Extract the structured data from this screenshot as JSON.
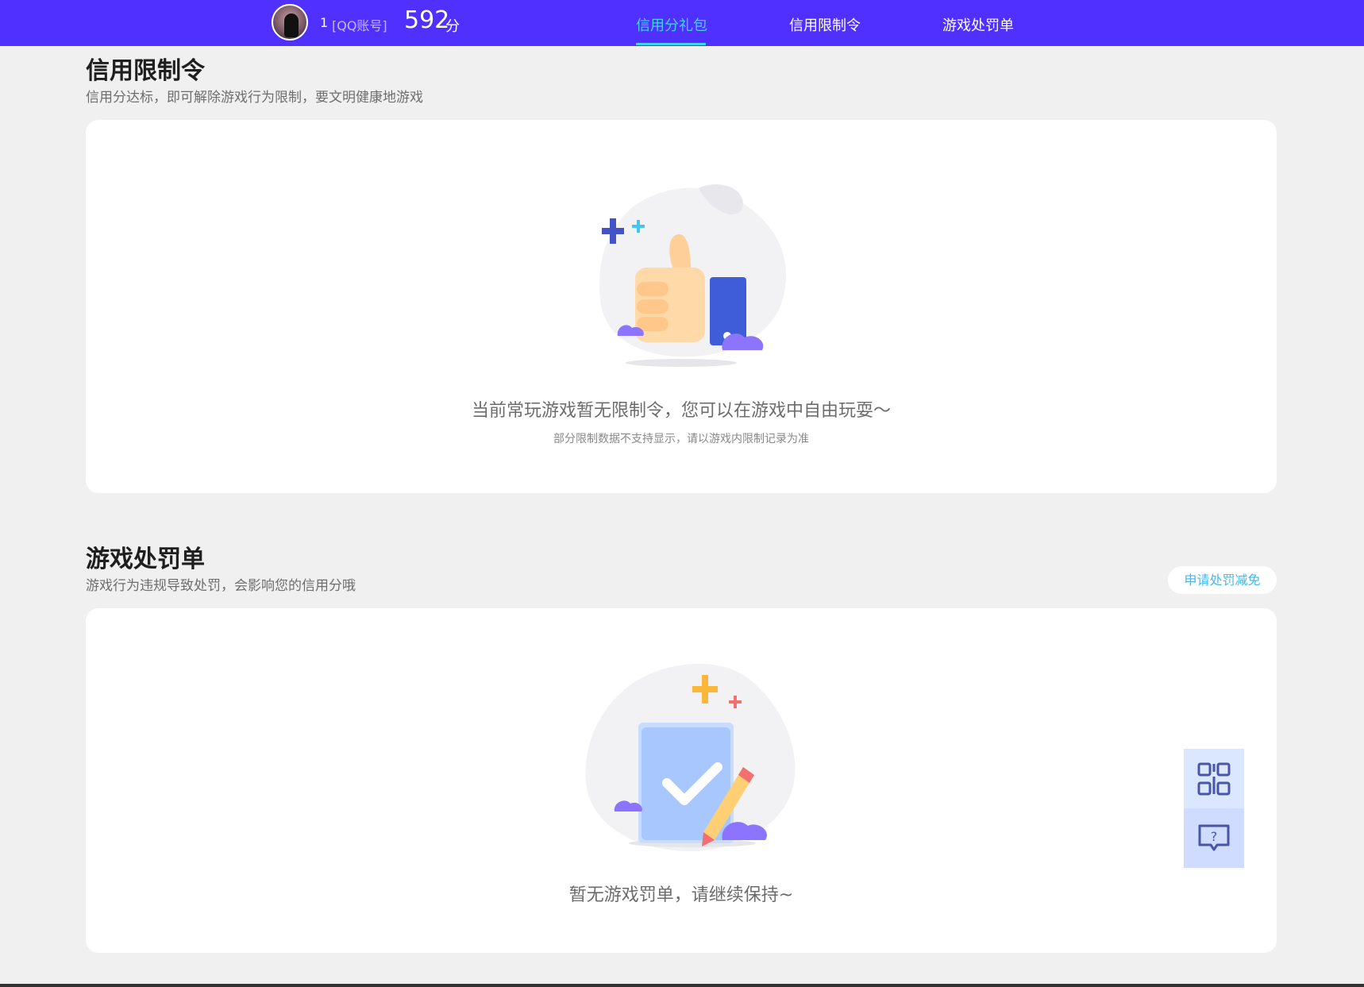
{
  "header": {
    "user_id": "1",
    "account_type": "[QQ账号]",
    "score": "592",
    "score_unit": "分",
    "tabs": [
      {
        "label": "信用分礼包",
        "active": true
      },
      {
        "label": "信用限制令",
        "active": false
      },
      {
        "label": "游戏处罚单",
        "active": false
      }
    ]
  },
  "restriction": {
    "title": "信用限制令",
    "subtitle": "信用分达标，即可解除游戏行为限制，要文明健康地游戏",
    "empty_text": "当前常玩游戏暂无限制令，您可以在游戏中自由玩耍～",
    "empty_note": "部分限制数据不支持显示，请以游戏内限制记录为准"
  },
  "penalty": {
    "title": "游戏处罚单",
    "subtitle": "游戏行为违规导致处罚，会影响您的信用分哦",
    "appeal_label": "申请处罚减免",
    "empty_text": "暂无游戏罚单，请继续保持~"
  },
  "side_tools": {
    "items": [
      {
        "icon": "qr-code-icon"
      },
      {
        "icon": "help-chat-icon"
      }
    ]
  },
  "colors": {
    "topbar": "#5030ff",
    "accent": "#3fd4ff",
    "link": "#3fb8ef",
    "background": "#f0f0f0"
  }
}
